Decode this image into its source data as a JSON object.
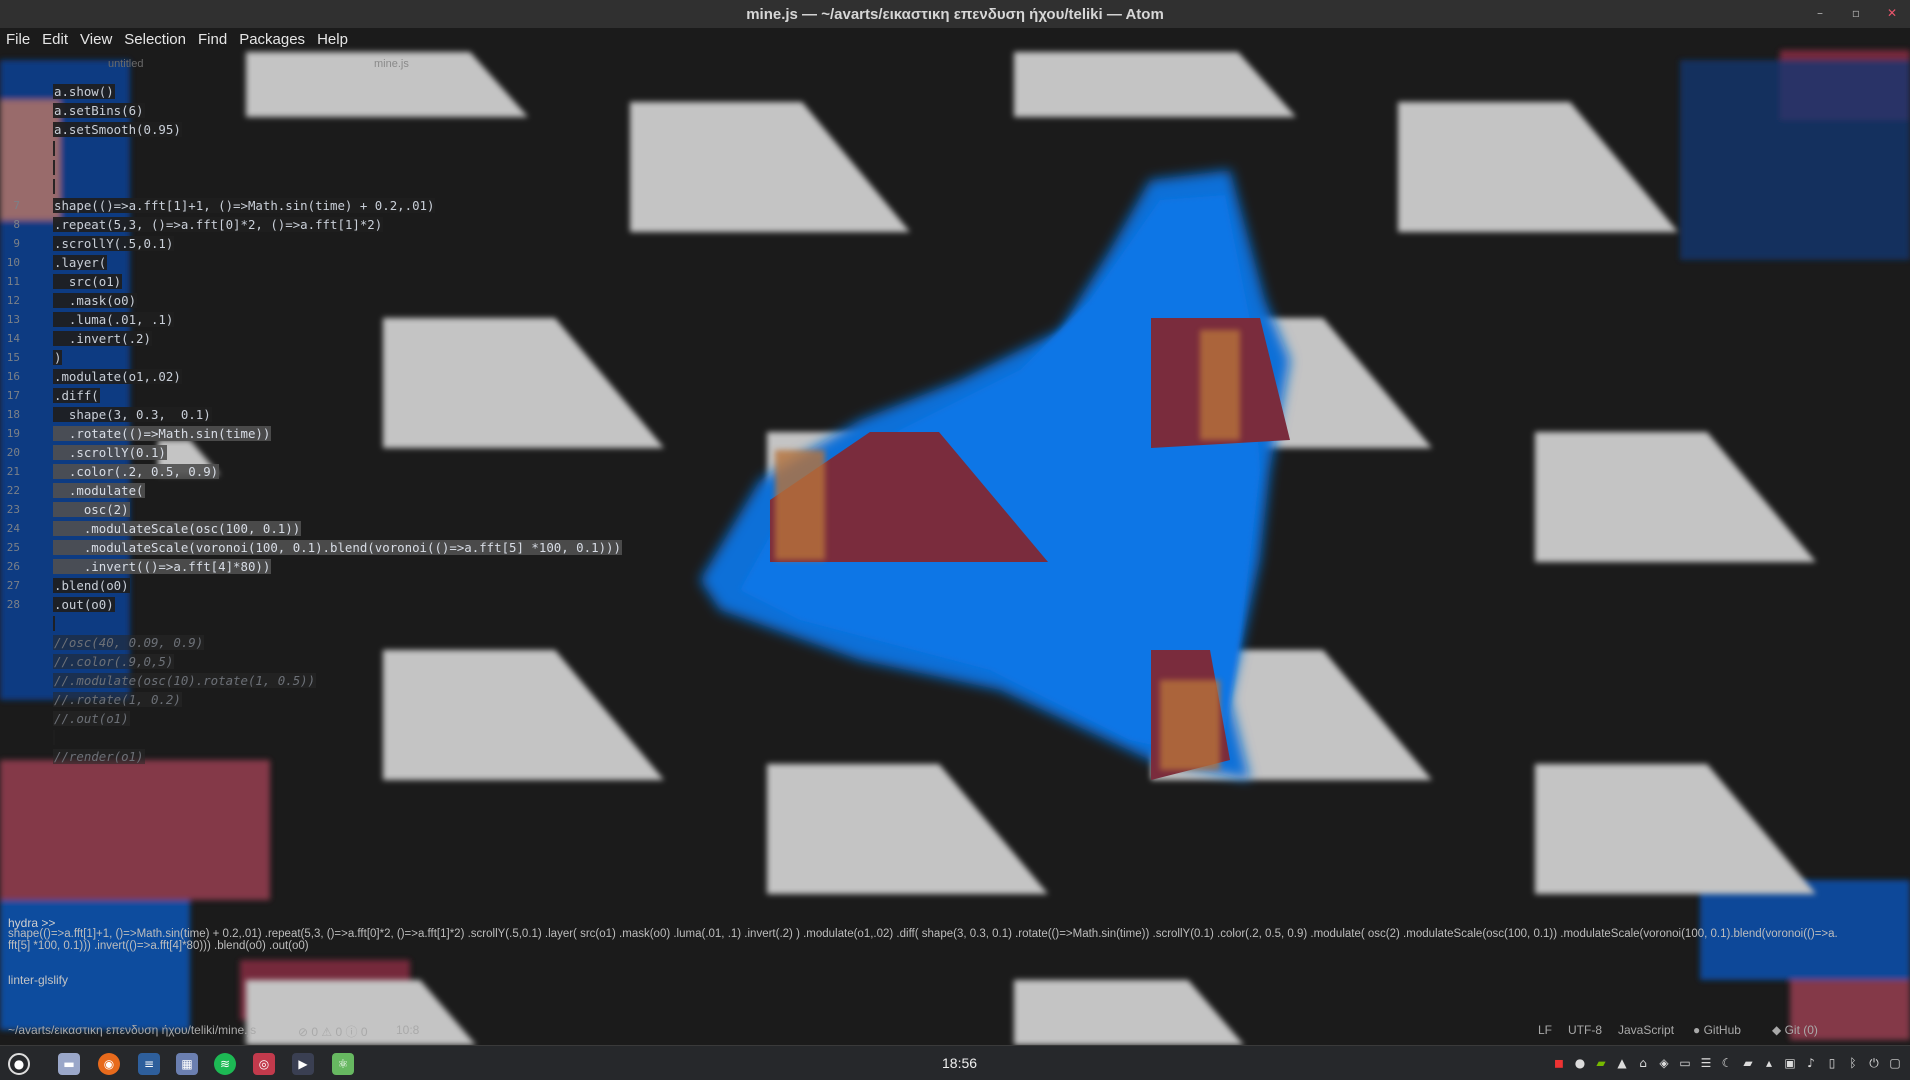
{
  "window": {
    "title": "mine.js — ~/avarts/εικαστικη επενδυση ήχου/teliki — Atom",
    "minimize": "–",
    "maximize": "▫",
    "close": "✕"
  },
  "menu": [
    "File",
    "Edit",
    "View",
    "Selection",
    "Find",
    "Packages",
    "Help"
  ],
  "tabs": {
    "untitled": "untitled",
    "mine": "mine.js"
  },
  "editor": {
    "lines": [
      {
        "num": "",
        "code": "a.show()"
      },
      {
        "num": "",
        "code": "a.setBins(6)"
      },
      {
        "num": "",
        "code": "a.setSmooth(0.95)"
      },
      {
        "num": "",
        "code": ""
      },
      {
        "num": "",
        "code": ""
      },
      {
        "num": "",
        "code": ""
      },
      {
        "num": "7",
        "code": "shape(()=>a.fft[1]+1, ()=>Math.sin(time) + 0.2,.01)"
      },
      {
        "num": "8",
        "code": ".repeat(5,3, ()=>a.fft[0]*2, ()=>a.fft[1]*2)"
      },
      {
        "num": "9",
        "code": ".scrollY(.5,0.1)"
      },
      {
        "num": "10",
        "code": ".layer("
      },
      {
        "num": "11",
        "code": "  src(o1)"
      },
      {
        "num": "12",
        "code": "  .mask(o0)"
      },
      {
        "num": "13",
        "code": "  .luma(.01, .1)"
      },
      {
        "num": "14",
        "code": "  .invert(.2)"
      },
      {
        "num": "15",
        "code": ")"
      },
      {
        "num": "16",
        "code": ".modulate(o1,.02)"
      },
      {
        "num": "17",
        "code": ".diff("
      },
      {
        "num": "18",
        "code": "  shape(3, 0.3,  0.1)"
      },
      {
        "num": "19",
        "code": "  .rotate(()=>Math.sin(time))"
      },
      {
        "num": "20",
        "code": "  .scrollY(0.1)"
      },
      {
        "num": "21",
        "code": "  .color(.2, 0.5, 0.9)"
      },
      {
        "num": "22",
        "code": "  .modulate("
      },
      {
        "num": "23",
        "code": "    osc(2)"
      },
      {
        "num": "24",
        "code": "    .modulateScale(osc(100, 0.1))"
      },
      {
        "num": "25",
        "code": "    .modulateScale(voronoi(100, 0.1).blend(voronoi(()=>a.fft[5] *100, 0.1)))"
      },
      {
        "num": "26",
        "code": "    .invert(()=>a.fft[4]*80))"
      },
      {
        "num": "27",
        "code": ".blend(o0)"
      },
      {
        "num": "28",
        "code": ".out(o0)"
      },
      {
        "num": "",
        "code": ""
      },
      {
        "num": "",
        "code": "//osc(40, 0.09, 0.9)"
      },
      {
        "num": "",
        "code": "//.color(.9,0,5)"
      },
      {
        "num": "",
        "code": "//.modulate(osc(10).rotate(1, 0.5))"
      },
      {
        "num": "",
        "code": "//.rotate(1, 0.2)"
      },
      {
        "num": "",
        "code": "//.out(o1)"
      },
      {
        "num": "",
        "code": ""
      },
      {
        "num": "",
        "code": "//render(o1)"
      }
    ]
  },
  "console": {
    "label": "hydra >>",
    "text": "shape(()=>a.fft[1]+1, ()=>Math.sin(time) + 0.2,.01) .repeat(5,3, ()=>a.fft[0]*2, ()=>a.fft[1]*2) .scrollY(.5,0.1) .layer( src(o1) .mask(o0) .luma(.01, .1) .invert(.2) ) .modulate(o1,.02) .diff( shape(3, 0.3, 0.1) .rotate(()=>Math.sin(time)) .scrollY(0.1) .color(.2, 0.5, 0.9) .modulate( osc(2) .modulateScale(osc(100, 0.1)) .modulateScale(voronoi(100, 0.1).blend(voronoi(()=>a.fft[5] *100, 0.1))) .invert(()=>a.fft[4]*80))) .blend(o0) .out(o0)"
  },
  "linter": "linter-glslify",
  "status": {
    "path": "~/avarts/εικαστικη επενδυση ήχου/teliki/mine.js",
    "diagnostics": "⊘ 0 ⚠ 0 ⓘ 0",
    "cursor": "10:8",
    "line_ending": "LF",
    "encoding": "UTF-8",
    "grammar": "JavaScript",
    "github": "GitHub",
    "git": "Git (0)"
  },
  "taskbar": {
    "clock": "18:56"
  },
  "colors": {
    "blue": "#0a6fd8",
    "maroon": "#7a2c3d",
    "grey_shape": "#c4c4c4",
    "background": "#1b1b1b"
  }
}
